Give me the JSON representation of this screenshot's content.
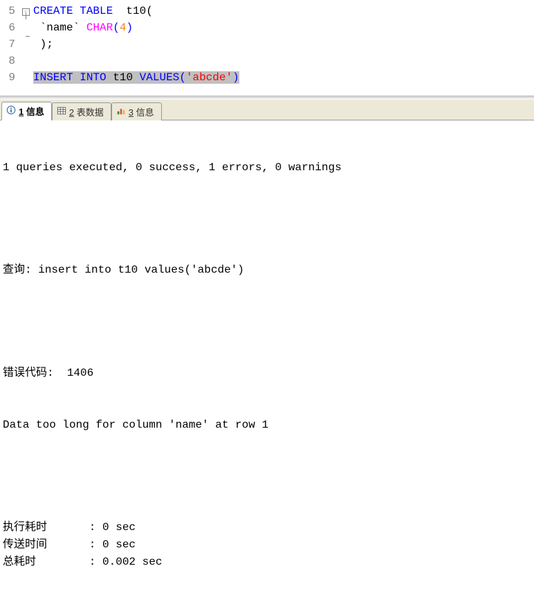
{
  "editor": {
    "lines": [
      {
        "num": "5",
        "fold": "start",
        "tokens": [
          {
            "t": "CREATE TABLE",
            "c": "kw"
          },
          {
            "t": "  ",
            "c": ""
          },
          {
            "t": "t10",
            "c": "ident"
          },
          {
            "t": "(",
            "c": "punct"
          }
        ]
      },
      {
        "num": "6",
        "fold": "mid",
        "tokens": [
          {
            "t": " ",
            "c": ""
          },
          {
            "t": "`name`",
            "c": "ident"
          },
          {
            "t": " ",
            "c": ""
          },
          {
            "t": "CHAR",
            "c": "type"
          },
          {
            "t": "(",
            "c": "paren-blue"
          },
          {
            "t": "4",
            "c": "num"
          },
          {
            "t": ")",
            "c": "paren-blue"
          }
        ]
      },
      {
        "num": "7",
        "fold": "end",
        "tokens": [
          {
            "t": " ",
            "c": ""
          },
          {
            "t": ");",
            "c": "punct"
          }
        ]
      },
      {
        "num": "8",
        "fold": "",
        "tokens": []
      },
      {
        "num": "9",
        "fold": "",
        "highlight": true,
        "tokens": [
          {
            "t": "INSERT INTO",
            "c": "kw"
          },
          {
            "t": " ",
            "c": ""
          },
          {
            "t": "t10",
            "c": "ident"
          },
          {
            "t": " ",
            "c": ""
          },
          {
            "t": "VALUES",
            "c": "kw"
          },
          {
            "t": "(",
            "c": "paren-blue"
          },
          {
            "t": "'abcde'",
            "c": "str"
          },
          {
            "t": ")",
            "c": "paren-blue"
          }
        ]
      }
    ]
  },
  "tabs": {
    "items": [
      {
        "id": "info",
        "prefix": "1",
        "label": " 信息",
        "active": true,
        "icon": "info-icon"
      },
      {
        "id": "tabledata",
        "prefix": "2",
        "label": " 表数据",
        "active": false,
        "icon": "table-icon"
      },
      {
        "id": "info2",
        "prefix": "3",
        "label": " 信息",
        "active": false,
        "icon": "chart-icon"
      }
    ]
  },
  "output": {
    "summary": "1 queries executed, 0 success, 1 errors, 0 warnings",
    "query_label": "查询",
    "query_text": "insert into t10 values('abcde')",
    "error_code_label": "错误代码",
    "error_code": "1406",
    "error_message": "Data too long for column 'name' at row 1",
    "stats": [
      {
        "label": "执行耗时",
        "value": "0 sec"
      },
      {
        "label": "传送时间",
        "value": "0 sec"
      },
      {
        "label": "总耗时",
        "value": "0.002 sec"
      }
    ]
  }
}
